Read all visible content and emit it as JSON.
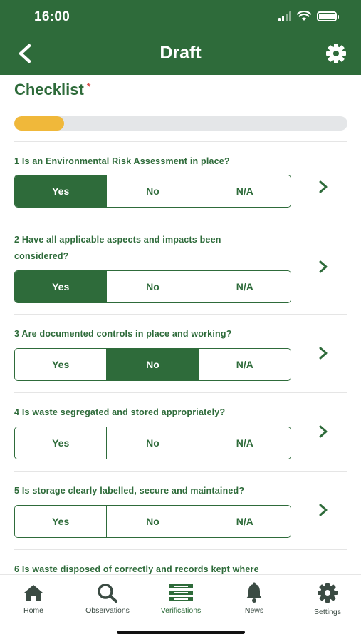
{
  "status_bar": {
    "time": "16:00"
  },
  "nav": {
    "title": "Draft",
    "back_icon": "chevron-left-icon",
    "settings_icon": "gear-icon"
  },
  "checklist": {
    "title": "Checklist",
    "required_marker": "*",
    "progress_fraction": 0.15,
    "colors": {
      "primary": "#2e6b3a",
      "progress": "#f0b83a",
      "track": "#e4e6e8",
      "required": "#d9534f"
    },
    "options": [
      "Yes",
      "No",
      "N/A"
    ],
    "questions": [
      {
        "text": "1 Is an Environmental Risk Assessment in place?",
        "selected": "Yes"
      },
      {
        "text": "2 Have all applicable aspects and impacts been considered?",
        "selected": "Yes"
      },
      {
        "text": "3 Are documented controls in place and working?",
        "selected": "No"
      },
      {
        "text": "4 Is waste segregated and stored appropriately?",
        "selected": ""
      },
      {
        "text": "5 Is storage clearly labelled, secure and maintained?",
        "selected": ""
      },
      {
        "text": "6 Is waste disposed of correctly and records kept where",
        "selected": ""
      }
    ]
  },
  "tabs": [
    {
      "label": "Home",
      "icon": "home-icon"
    },
    {
      "label": "Observations",
      "icon": "search-icon"
    },
    {
      "label": "Verifications",
      "icon": "list-icon"
    },
    {
      "label": "News",
      "icon": "bell-icon"
    },
    {
      "label": "Settings",
      "icon": "gear-icon"
    }
  ]
}
